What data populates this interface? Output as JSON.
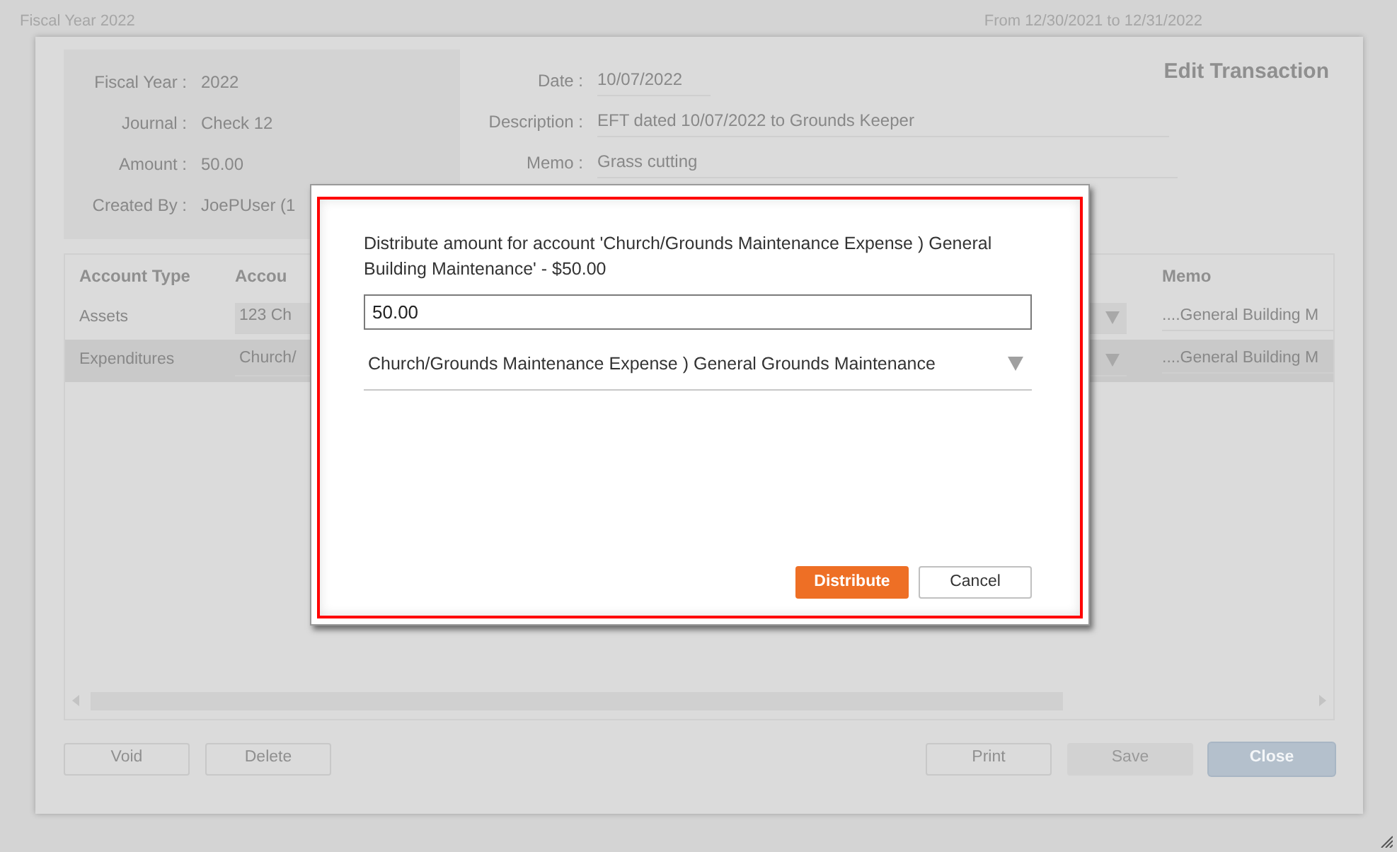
{
  "background_page": {
    "fiscal_year": "Fiscal Year 2022",
    "date_range": "From 12/30/2021 to 12/31/2022"
  },
  "edit_dialog": {
    "title": "Edit Transaction",
    "info": [
      {
        "label": "Fiscal Year :",
        "value": "2022"
      },
      {
        "label": "Journal :",
        "value": "Check 12"
      },
      {
        "label": "Amount :",
        "value": "50.00"
      },
      {
        "label": "Created By :",
        "value": "JoePUser (1"
      }
    ],
    "fields": [
      {
        "label": "Date :",
        "value": "10/07/2022"
      },
      {
        "label": "Description :",
        "value": "EFT dated 10/07/2022 to Grounds Keeper"
      },
      {
        "label": "Memo :",
        "value": "Grass cutting"
      }
    ],
    "table": {
      "columns": [
        "Account Type",
        "Accou",
        "Memo"
      ],
      "rows": [
        {
          "account_type": "Assets",
          "account": "123 Ch",
          "memo": "....General Building M",
          "selected": false
        },
        {
          "account_type": "Expenditures",
          "account": "Church/",
          "memo": "....General Building M",
          "selected": true
        }
      ]
    },
    "buttons": [
      {
        "label": "Void",
        "kind": "outline",
        "disabled": true
      },
      {
        "label": "Delete",
        "kind": "outline",
        "disabled": true
      },
      {
        "label": "Print",
        "kind": "outline",
        "disabled": true
      },
      {
        "label": "Save",
        "kind": "filled",
        "disabled": true
      },
      {
        "label": "Close",
        "kind": "primary",
        "disabled": false
      }
    ]
  },
  "distribute_dialog": {
    "message": "Distribute amount for account 'Church/Grounds Maintenance Expense ) General Building Maintenance' - $50.00",
    "amount": "50.00",
    "account": "Church/Grounds Maintenance Expense ) General Grounds Maintenance",
    "buttons": [
      {
        "label": "Distribute",
        "kind": "primary"
      },
      {
        "label": "Cancel",
        "kind": "outline"
      }
    ]
  }
}
